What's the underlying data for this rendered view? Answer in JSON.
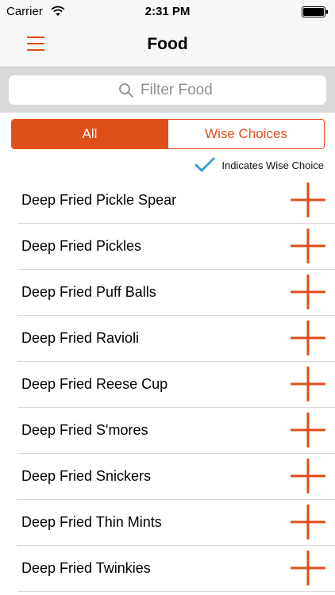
{
  "status_bar": {
    "carrier": "Carrier",
    "time": "2:31 PM",
    "wifi_icon": "wifi-icon",
    "battery_icon": "battery-icon"
  },
  "nav": {
    "title": "Food",
    "menu_icon": "hamburger-menu-icon"
  },
  "search": {
    "placeholder": "Filter Food",
    "value": "",
    "icon": "search-icon"
  },
  "filter_tabs": {
    "all_label": "All",
    "wise_label": "Wise Choices",
    "selected": "All"
  },
  "legend": {
    "icon": "checkmark-icon",
    "text": "Indicates Wise Choice"
  },
  "food_items": [
    {
      "name": "Deep Fried Pickle Spear"
    },
    {
      "name": "Deep Fried Pickles"
    },
    {
      "name": "Deep Fried Puff Balls"
    },
    {
      "name": "Deep Fried Ravioli"
    },
    {
      "name": "Deep Fried Reese Cup"
    },
    {
      "name": "Deep Fried S'mores"
    },
    {
      "name": "Deep Fried Snickers"
    },
    {
      "name": "Deep Fried Thin Mints"
    },
    {
      "name": "Deep Fried Twinkies"
    }
  ],
  "colors": {
    "accent": "#e04e1a",
    "check": "#3aa0d8"
  }
}
